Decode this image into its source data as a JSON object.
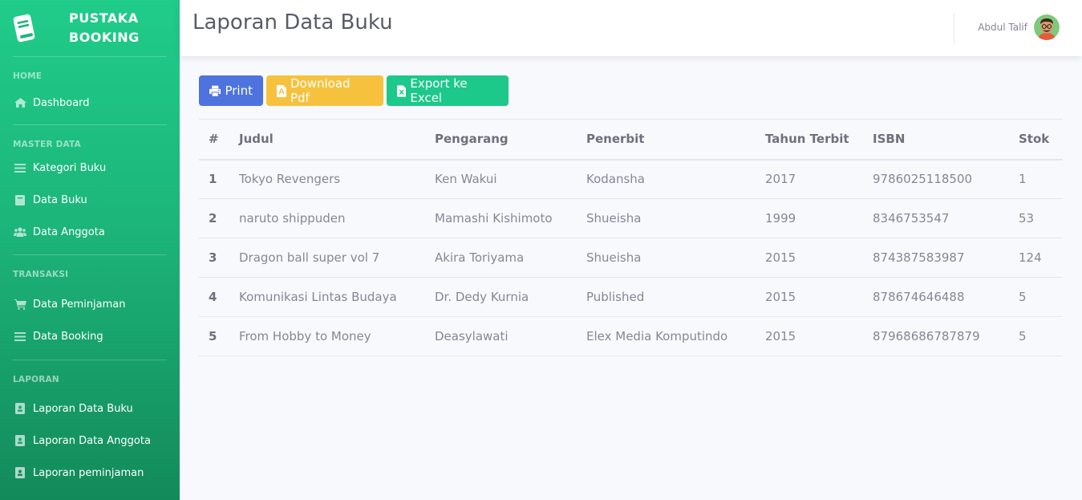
{
  "sidebar": {
    "brand_line1": "PUSTAKA",
    "brand_line2": "BOOKING",
    "sections": {
      "home": "HOME",
      "master": "MASTER DATA",
      "transaksi": "TRANSAKSI",
      "laporan": "LAPORAN"
    },
    "items": {
      "dashboard": "Dashboard",
      "kategori": "Kategori Buku",
      "data_buku": "Data Buku",
      "data_anggota": "Data Anggota",
      "peminjaman": "Data Peminjaman",
      "booking": "Data Booking",
      "lap_buku": "Laporan Data Buku",
      "lap_anggota": "Laporan Data Anggota",
      "lap_peminjaman": "Laporan peminjaman"
    },
    "icons": {
      "dashboard": "home-icon",
      "kategori": "list-icon",
      "data_buku": "book-icon",
      "data_anggota": "users-icon",
      "peminjaman": "cart-icon",
      "booking": "list-icon",
      "lap_buku": "address-book-icon",
      "lap_anggota": "address-book-icon",
      "lap_peminjaman": "address-book-icon"
    }
  },
  "header": {
    "title": "Laporan Data Buku",
    "user_name": "Abdul Talif"
  },
  "toolbar": {
    "print": "Print",
    "pdf": "Download Pdf",
    "excel": "Export ke Excel"
  },
  "colors": {
    "sidebar_top": "#20cc8a",
    "sidebar_bottom": "#138a5a",
    "print": "#4e73df",
    "pdf": "#f6c23e",
    "excel": "#1cc88a"
  },
  "table": {
    "headers": [
      "#",
      "Judul",
      "Pengarang",
      "Penerbit",
      "Tahun Terbit",
      "ISBN",
      "Stok"
    ],
    "rows": [
      [
        "1",
        "Tokyo Revengers",
        "Ken Wakui",
        "Kodansha",
        "2017",
        "9786025118500",
        "1"
      ],
      [
        "2",
        "naruto shippuden",
        "Mamashi Kishimoto",
        "Shueisha",
        "1999",
        "8346753547",
        "53"
      ],
      [
        "3",
        "Dragon ball super vol 7",
        "Akira Toriyama",
        "Shueisha",
        "2015",
        "874387583987",
        "124"
      ],
      [
        "4",
        "Komunikasi Lintas Budaya",
        "Dr. Dedy Kurnia",
        "Published",
        "2015",
        "878674646488",
        "5"
      ],
      [
        "5",
        "From Hobby to Money",
        "Deasylawati",
        "Elex Media Komputindo",
        "2015",
        "87968686787879",
        "5"
      ]
    ]
  }
}
